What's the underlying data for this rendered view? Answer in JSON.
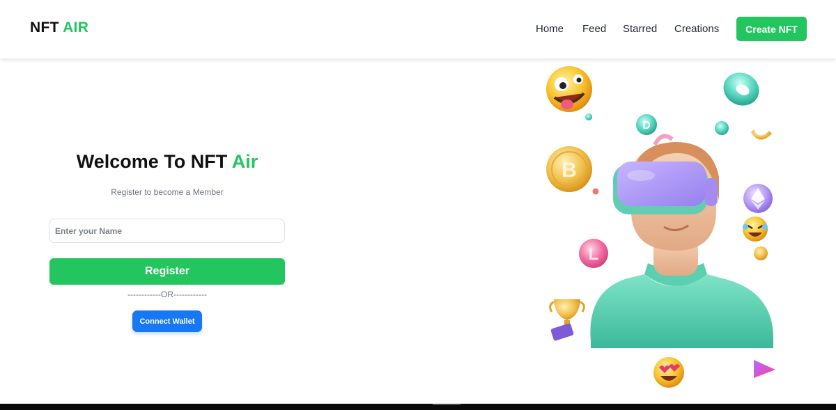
{
  "header": {
    "brand": {
      "primary": "NFT",
      "accent": "AIR"
    },
    "nav": [
      {
        "label": "Home"
      },
      {
        "label": "Feed"
      },
      {
        "label": "Starred"
      },
      {
        "label": "Creations"
      }
    ],
    "cta_label": "Create NFT"
  },
  "form": {
    "title_prefix": "Welcome To NFT",
    "title_accent": "Air",
    "subtitle": "Register to become a Member",
    "name_input": {
      "placeholder": "Enter your Name",
      "value": ""
    },
    "register_label": "Register",
    "divider": "------------OR------------",
    "wallet_label": "Connect Wallet"
  },
  "illustration": {
    "icons": [
      "vr-avatar",
      "crazy-face-emoji",
      "bitcoin-coin",
      "litecoin-coin",
      "ethereum-coin",
      "trophy",
      "heart-eyes-emoji",
      "laughing-emoji",
      "torus",
      "play-triangle",
      "dash-coin"
    ]
  },
  "colors": {
    "accent": "#22c55e",
    "wallet": "#1877f2",
    "text": "#111111",
    "muted": "#6b7280"
  }
}
